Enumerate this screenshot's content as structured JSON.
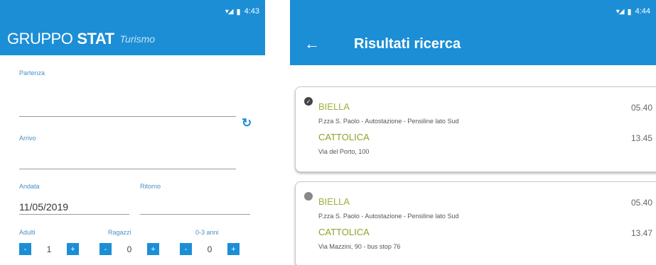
{
  "left": {
    "status": {
      "signal": "▾◢",
      "battery": "▮",
      "time": "4:43"
    },
    "brand": {
      "part1": "GRUPPO",
      "part2": "STAT",
      "part3": "Turismo"
    },
    "form": {
      "partenza_label": "Partenza",
      "arrivo_label": "Arrivo",
      "andata_label": "Andata",
      "andata_value": "11/05/2019",
      "ritorno_label": "Ritorno",
      "adulti_label": "Adulti",
      "ragazzi_label": "Ragazzi",
      "bambini_label": "0-3 anni",
      "adulti_value": "1",
      "ragazzi_value": "0",
      "bambini_value": "0",
      "minus": "-",
      "plus": "+"
    }
  },
  "right": {
    "status": {
      "signal": "▾◢",
      "battery": "▮",
      "time": "4:44"
    },
    "title": "Risultati ricerca",
    "back_icon": "←",
    "results": [
      {
        "from": "BIELLA",
        "from_address": "P.zza S. Paolo - Autostazione - Pensiline lato Sud",
        "to": "CATTOLICA",
        "to_address": "Via del Porto, 100",
        "depart": "05.40",
        "arrive": "13.45",
        "selected": true
      },
      {
        "from": "BIELLA",
        "from_address": "P.zza S. Paolo - Autostazione - Pensiline lato Sud",
        "to": "CATTOLICA",
        "to_address": "Via Mazzini, 90 - bus stop 76",
        "depart": "05.40",
        "arrive": "13.47",
        "selected": false
      }
    ]
  },
  "colors": {
    "primary": "#1c8ed6",
    "city": "#9bb23a"
  }
}
